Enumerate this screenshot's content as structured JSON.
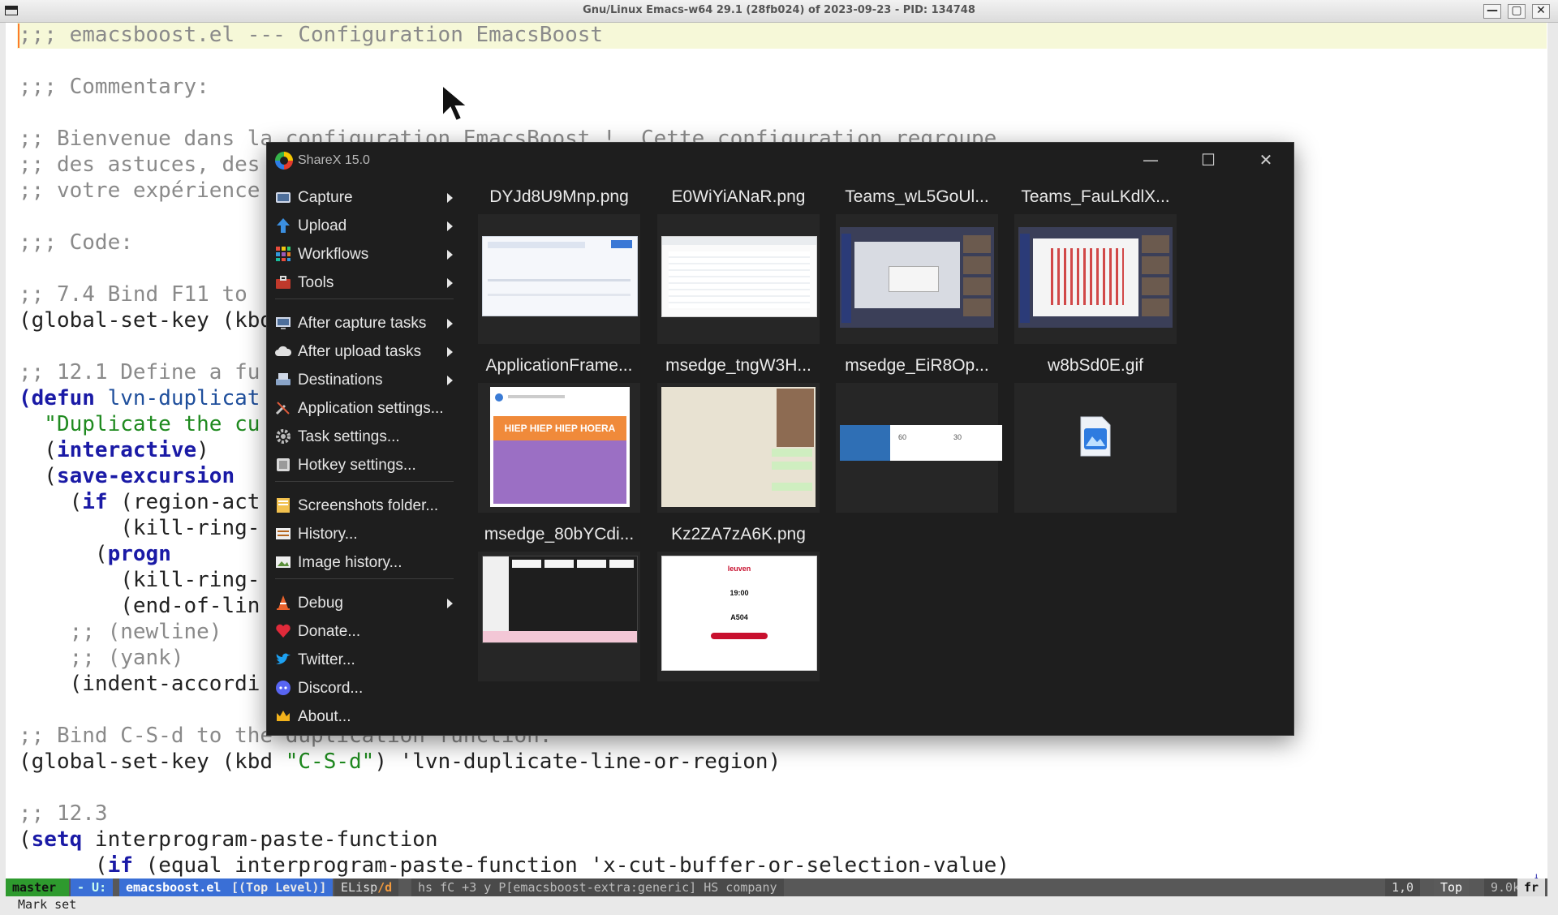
{
  "emacs": {
    "title": "Gnu/Linux Emacs-w64 29.1 (28fb024) of 2023-09-23 - PID: 134748",
    "buttons": {
      "minimize": "—",
      "maximize": "▢",
      "close": "✕"
    },
    "lines": [
      ";;; emacsboost.el --- Configuration EmacsBoost",
      "",
      ";;; Commentary:",
      "",
      ";; Bienvenue dans la configuration EmacsBoost !  Cette configuration regroupe",
      ";; des astuces, des",
      ";; votre expérience",
      "",
      ";;; Code:",
      "",
      ";; 7.4 Bind F11 to",
      "(global-set-key (kbd",
      "",
      ";; 12.1 Define a fu",
      "(defun",
      "lvn-duplicat",
      "  \"Duplicate the cu",
      "  (",
      "interactive",
      ")",
      "  (",
      "save-excursion",
      "    (",
      "if",
      " (region-act",
      "        (kill-ring-",
      "      (",
      "progn",
      "        (kill-ring-",
      "        (end-of-lin",
      "    ;; (newline)",
      "    ;; (yank)",
      "    (indent-accordi",
      "",
      ";; Bind C-S-d to the duplication function.",
      "(global-set-key (kbd ",
      "\"C-S-d\"",
      ") 'lvn-duplicate-line-or-region)",
      "",
      ";; 12.3",
      "(",
      "setq",
      " interprogram-paste-function",
      "      (",
      "if",
      " (equal interprogram-paste-function 'x-cut-buffer-or-selection-value)"
    ],
    "modeline": {
      "branch": "master",
      "state": "- U:",
      "file": "emacsboost.el",
      "level": "[(Top Level)]",
      "mode_a": "ELisp",
      "mode_b": "/d",
      "minor": "hs fC +3 y P[emacsboost-extra:generic] HS company",
      "pos": "1,0",
      "top": "Top",
      "size": "9.0k",
      "lang": "fr"
    },
    "echo": "Mark set"
  },
  "sharex": {
    "title": "ShareX 15.0",
    "buttons": {
      "minimize": "—",
      "maximize": "☐",
      "close": "✕"
    },
    "menu": [
      {
        "label": "Capture",
        "icon": "camera-icon",
        "submenu": true
      },
      {
        "label": "Upload",
        "icon": "upload-arrow-icon",
        "submenu": true
      },
      {
        "label": "Workflows",
        "icon": "grid-icon",
        "submenu": true
      },
      {
        "label": "Tools",
        "icon": "toolbox-icon",
        "submenu": true
      },
      {
        "label": "After capture tasks",
        "icon": "monitor-icon",
        "submenu": true
      },
      {
        "label": "After upload tasks",
        "icon": "cloud-icon",
        "submenu": true
      },
      {
        "label": "Destinations",
        "icon": "drive-icon",
        "submenu": true
      },
      {
        "label": "Application settings...",
        "icon": "wrench-icon",
        "submenu": false
      },
      {
        "label": "Task settings...",
        "icon": "gear-icon",
        "submenu": false
      },
      {
        "label": "Hotkey settings...",
        "icon": "keyboard-icon",
        "submenu": false
      },
      {
        "label": "Screenshots folder...",
        "icon": "folder-icon",
        "submenu": false
      },
      {
        "label": "History...",
        "icon": "history-icon",
        "submenu": false
      },
      {
        "label": "Image history...",
        "icon": "image-history-icon",
        "submenu": false
      },
      {
        "label": "Debug",
        "icon": "traffic-cone-icon",
        "submenu": true
      },
      {
        "label": "Donate...",
        "icon": "heart-icon",
        "submenu": false
      },
      {
        "label": "Twitter...",
        "icon": "twitter-bird-icon",
        "submenu": false
      },
      {
        "label": "Discord...",
        "icon": "discord-icon",
        "submenu": false
      },
      {
        "label": "About...",
        "icon": "crown-icon",
        "submenu": false
      }
    ],
    "files": [
      "DYJd8U9Mnp.png",
      "E0WiYiANaR.png",
      "Teams_wL5GoUl...",
      "Teams_FauLKdlX...",
      "ApplicationFrame...",
      "msedge_tngW3H...",
      "msedge_EiR8Op...",
      "w8bSd0E.gif",
      "msedge_80bYCdi...",
      "Kz2ZA7zA6K.png"
    ],
    "thumb_texts": {
      "hiep": "HIEP HIEP HIEP HOERA",
      "leuven": "leuven",
      "time": "19:00",
      "room": "A504",
      "cal_a": "60",
      "cal_b": "30"
    }
  }
}
